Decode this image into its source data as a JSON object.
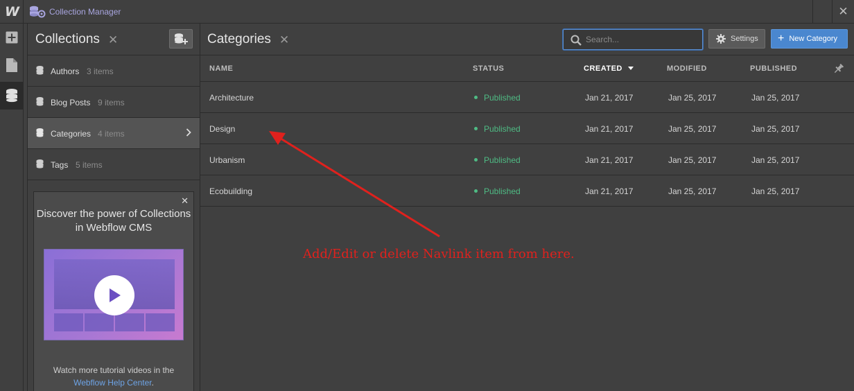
{
  "topbar": {
    "logo": "W",
    "title": "Collection Manager",
    "close": "✕"
  },
  "collections_panel": {
    "title": "Collections",
    "close": "✕",
    "items": [
      {
        "name": "Authors",
        "count": "3 items"
      },
      {
        "name": "Blog Posts",
        "count": "9 items"
      },
      {
        "name": "Categories",
        "count": "4 items"
      },
      {
        "name": "Tags",
        "count": "5 items"
      }
    ]
  },
  "promo": {
    "close": "✕",
    "title": "Discover the power of Collections in Webflow CMS",
    "text_before": "Watch more tutorial videos in the",
    "link": "Webflow Help Center",
    "text_after": "."
  },
  "main": {
    "title": "Categories",
    "close": "✕",
    "search_placeholder": "Search...",
    "settings_label": "Settings",
    "new_label": "New Category",
    "columns": {
      "name": "NAME",
      "status": "STATUS",
      "created": "CREATED",
      "modified": "MODIFIED",
      "published": "PUBLISHED"
    },
    "rows": [
      {
        "name": "Architecture",
        "status": "Published",
        "created": "Jan 21, 2017",
        "modified": "Jan 25, 2017",
        "published": "Jan 25, 2017"
      },
      {
        "name": "Design",
        "status": "Published",
        "created": "Jan 21, 2017",
        "modified": "Jan 25, 2017",
        "published": "Jan 25, 2017"
      },
      {
        "name": "Urbanism",
        "status": "Published",
        "created": "Jan 21, 2017",
        "modified": "Jan 25, 2017",
        "published": "Jan 25, 2017"
      },
      {
        "name": "Ecobuilding",
        "status": "Published",
        "created": "Jan 21, 2017",
        "modified": "Jan 25, 2017",
        "published": "Jan 25, 2017"
      }
    ]
  },
  "annotation": {
    "text": "Add/Edit or delete Navlink item from here."
  },
  "colors": {
    "accent": "#4a87cf",
    "published": "#4fbb84",
    "annotation": "#e0211d"
  }
}
